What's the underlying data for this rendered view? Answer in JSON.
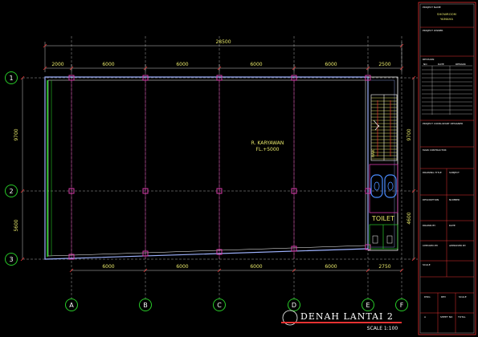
{
  "drawing": {
    "title": "DENAH LANTAI 2",
    "scale": "SCALE 1:100",
    "room_label": "R. KARYAWAN",
    "room_level": "FL.+5000",
    "toilet_label": "TOILET"
  },
  "dimensions": {
    "overall": "28500",
    "top": [
      "2000",
      "6000",
      "6000",
      "6000",
      "6000",
      "2500"
    ],
    "bottom": [
      "6000",
      "6000",
      "6000",
      "6000",
      "2750"
    ],
    "left": [
      "9700",
      "5600"
    ],
    "right": [
      "9700",
      "4600"
    ]
  },
  "grid": {
    "rows": [
      "1",
      "2",
      "3"
    ],
    "columns": [
      "A",
      "B",
      "C",
      "D",
      "E",
      "F"
    ]
  },
  "title_block": {
    "project_name_label": "PROJECT NAME",
    "project_name": [
      "SHOWROOM",
      "YAMAHA"
    ],
    "owner_label": "PROJECT OWNER",
    "revision_label": "REVISION",
    "rev_cols": [
      "NO",
      "DATE",
      "REMARK"
    ],
    "consultant_label": "PROJECT CONSULTANT DESIGNER",
    "contractor_label": "MAIN CONTRACTOR",
    "drawing_label": "DRAWING TITLE",
    "subject_label": "SUBJECT",
    "description_label": "DESCRIPTION",
    "number_label": "NUMBER",
    "drawn_label": "DRAWN BY",
    "date_label": "DATE",
    "checked_label": "CHECKED BY",
    "approved_label": "APPROVED BY",
    "scale_label": "SCALE",
    "sheet_cols": [
      "DWG",
      "REV",
      "SCALE"
    ],
    "sheet_vals": [
      "A",
      "SHEET NO",
      "TOTAL"
    ]
  }
}
